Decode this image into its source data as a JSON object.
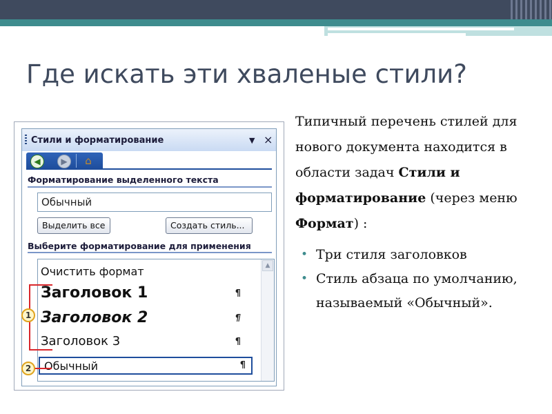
{
  "slide": {
    "title": "Где искать эти хваленые стили?",
    "description": {
      "text_1": "Типичный перечень стилей для нового документа находится в области задач ",
      "bold_1": "Стили и форматирование",
      "text_2": " (через меню ",
      "bold_2": "Формат",
      "text_3": ") :"
    },
    "bullets": [
      "Три стиля заголовков",
      "Стиль абзаца по умолчанию, называемый «Обычный»."
    ],
    "colors": {
      "title": "#3f4a5e",
      "accent_teal": "#3e8c8e",
      "callout_red": "#d9262b"
    }
  },
  "pane": {
    "title": "Стили и форматирование",
    "dropdown_icon": "▼",
    "close_icon": "×",
    "nav": {
      "back_icon": "◀",
      "forward_icon": "▶",
      "home_icon": "⌂"
    },
    "section_selected": "Форматирование выделенного текста",
    "current_style": "Обычный",
    "btn_select_all": "Выделить все",
    "btn_create_style": "Создать стиль...",
    "section_apply": "Выберите форматирование для применения",
    "list": {
      "clear": "Очистить формат",
      "heading1": "Заголовок 1",
      "heading2": "Заголовок 2",
      "heading3": "Заголовок 3",
      "normal": "Обычный",
      "pilcrow": "¶",
      "scroll_up_icon": "▲"
    }
  },
  "callouts": {
    "one": "1",
    "two": "2"
  }
}
